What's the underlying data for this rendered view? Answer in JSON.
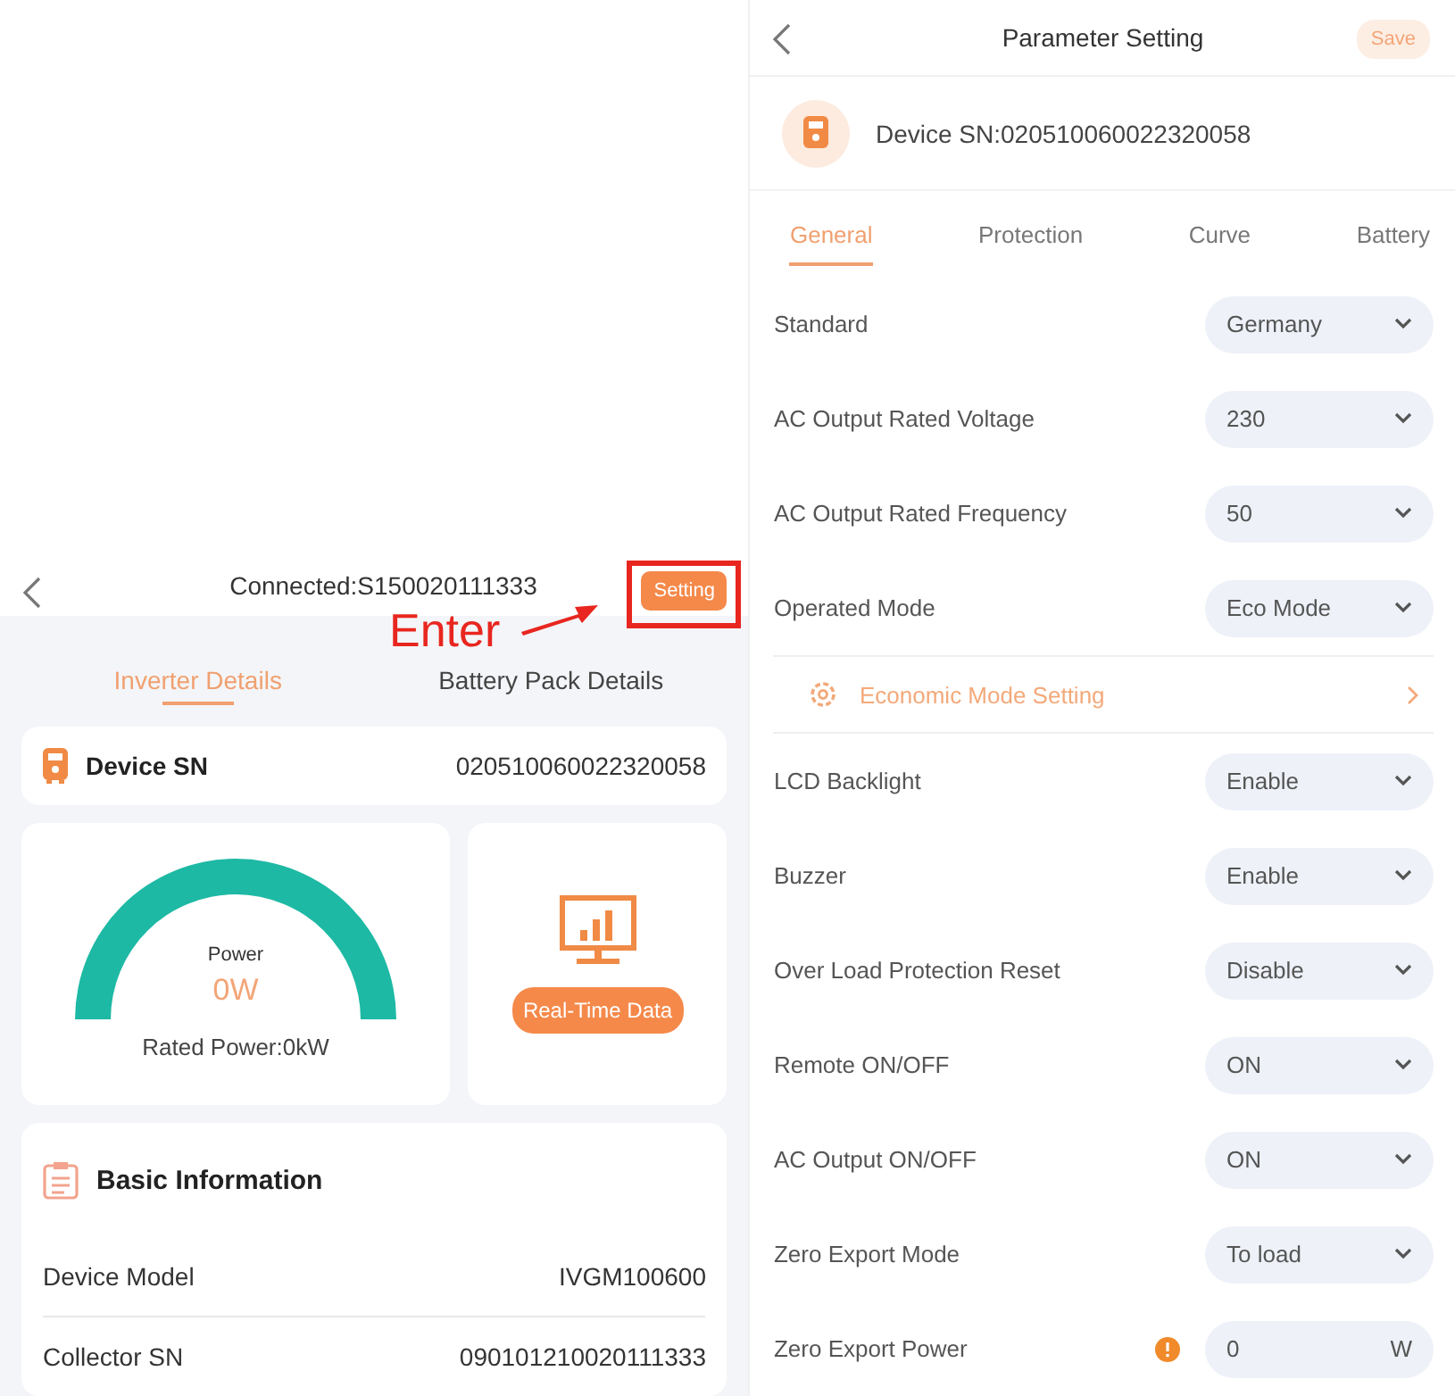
{
  "left_screen": {
    "header": {
      "title": "Connected:S150020111333",
      "setting_button": "Setting"
    },
    "annotation": {
      "text": "Enter"
    },
    "tabs": [
      {
        "label": "Inverter Details",
        "selected": true
      },
      {
        "label": "Battery Pack Details",
        "selected": false
      }
    ],
    "device_sn": {
      "label": "Device SN",
      "value": "020510060022320058"
    },
    "power_card": {
      "label": "Power",
      "value": "0W",
      "rated": "Rated Power:0kW"
    },
    "realtime_button": "Real-Time Data",
    "basic_information": {
      "title": "Basic Information",
      "rows": [
        {
          "label": "Device Model",
          "value": "IVGM100600"
        },
        {
          "label": "Collector SN",
          "value": "090101210020111333"
        }
      ]
    }
  },
  "right_screen": {
    "header": {
      "title": "Parameter Setting",
      "save_button": "Save"
    },
    "device": "Device SN:020510060022320058",
    "tabs": [
      {
        "label": "General",
        "selected": true
      },
      {
        "label": "Protection",
        "selected": false
      },
      {
        "label": "Curve",
        "selected": false
      },
      {
        "label": "Battery",
        "selected": false
      }
    ],
    "rows": [
      {
        "kind": "select",
        "label": "Standard",
        "value": "Germany"
      },
      {
        "kind": "select",
        "label": "AC Output Rated Voltage",
        "value": "230"
      },
      {
        "kind": "select",
        "label": "AC Output Rated Frequency",
        "value": "50"
      },
      {
        "kind": "select",
        "label": "Operated Mode",
        "value": "Eco Mode"
      },
      {
        "kind": "link",
        "label": "Economic Mode Setting"
      },
      {
        "kind": "select",
        "label": "LCD Backlight",
        "value": "Enable"
      },
      {
        "kind": "select",
        "label": "Buzzer",
        "value": "Enable"
      },
      {
        "kind": "select",
        "label": "Over Load Protection Reset",
        "value": "Disable"
      },
      {
        "kind": "select",
        "label": "Remote ON/OFF",
        "value": "ON"
      },
      {
        "kind": "select",
        "label": "AC Output ON/OFF",
        "value": "ON"
      },
      {
        "kind": "select",
        "label": "Zero Export Mode",
        "value": "To load"
      },
      {
        "kind": "input",
        "label": "Zero Export Power",
        "value": "0",
        "unit": "W"
      }
    ]
  }
}
